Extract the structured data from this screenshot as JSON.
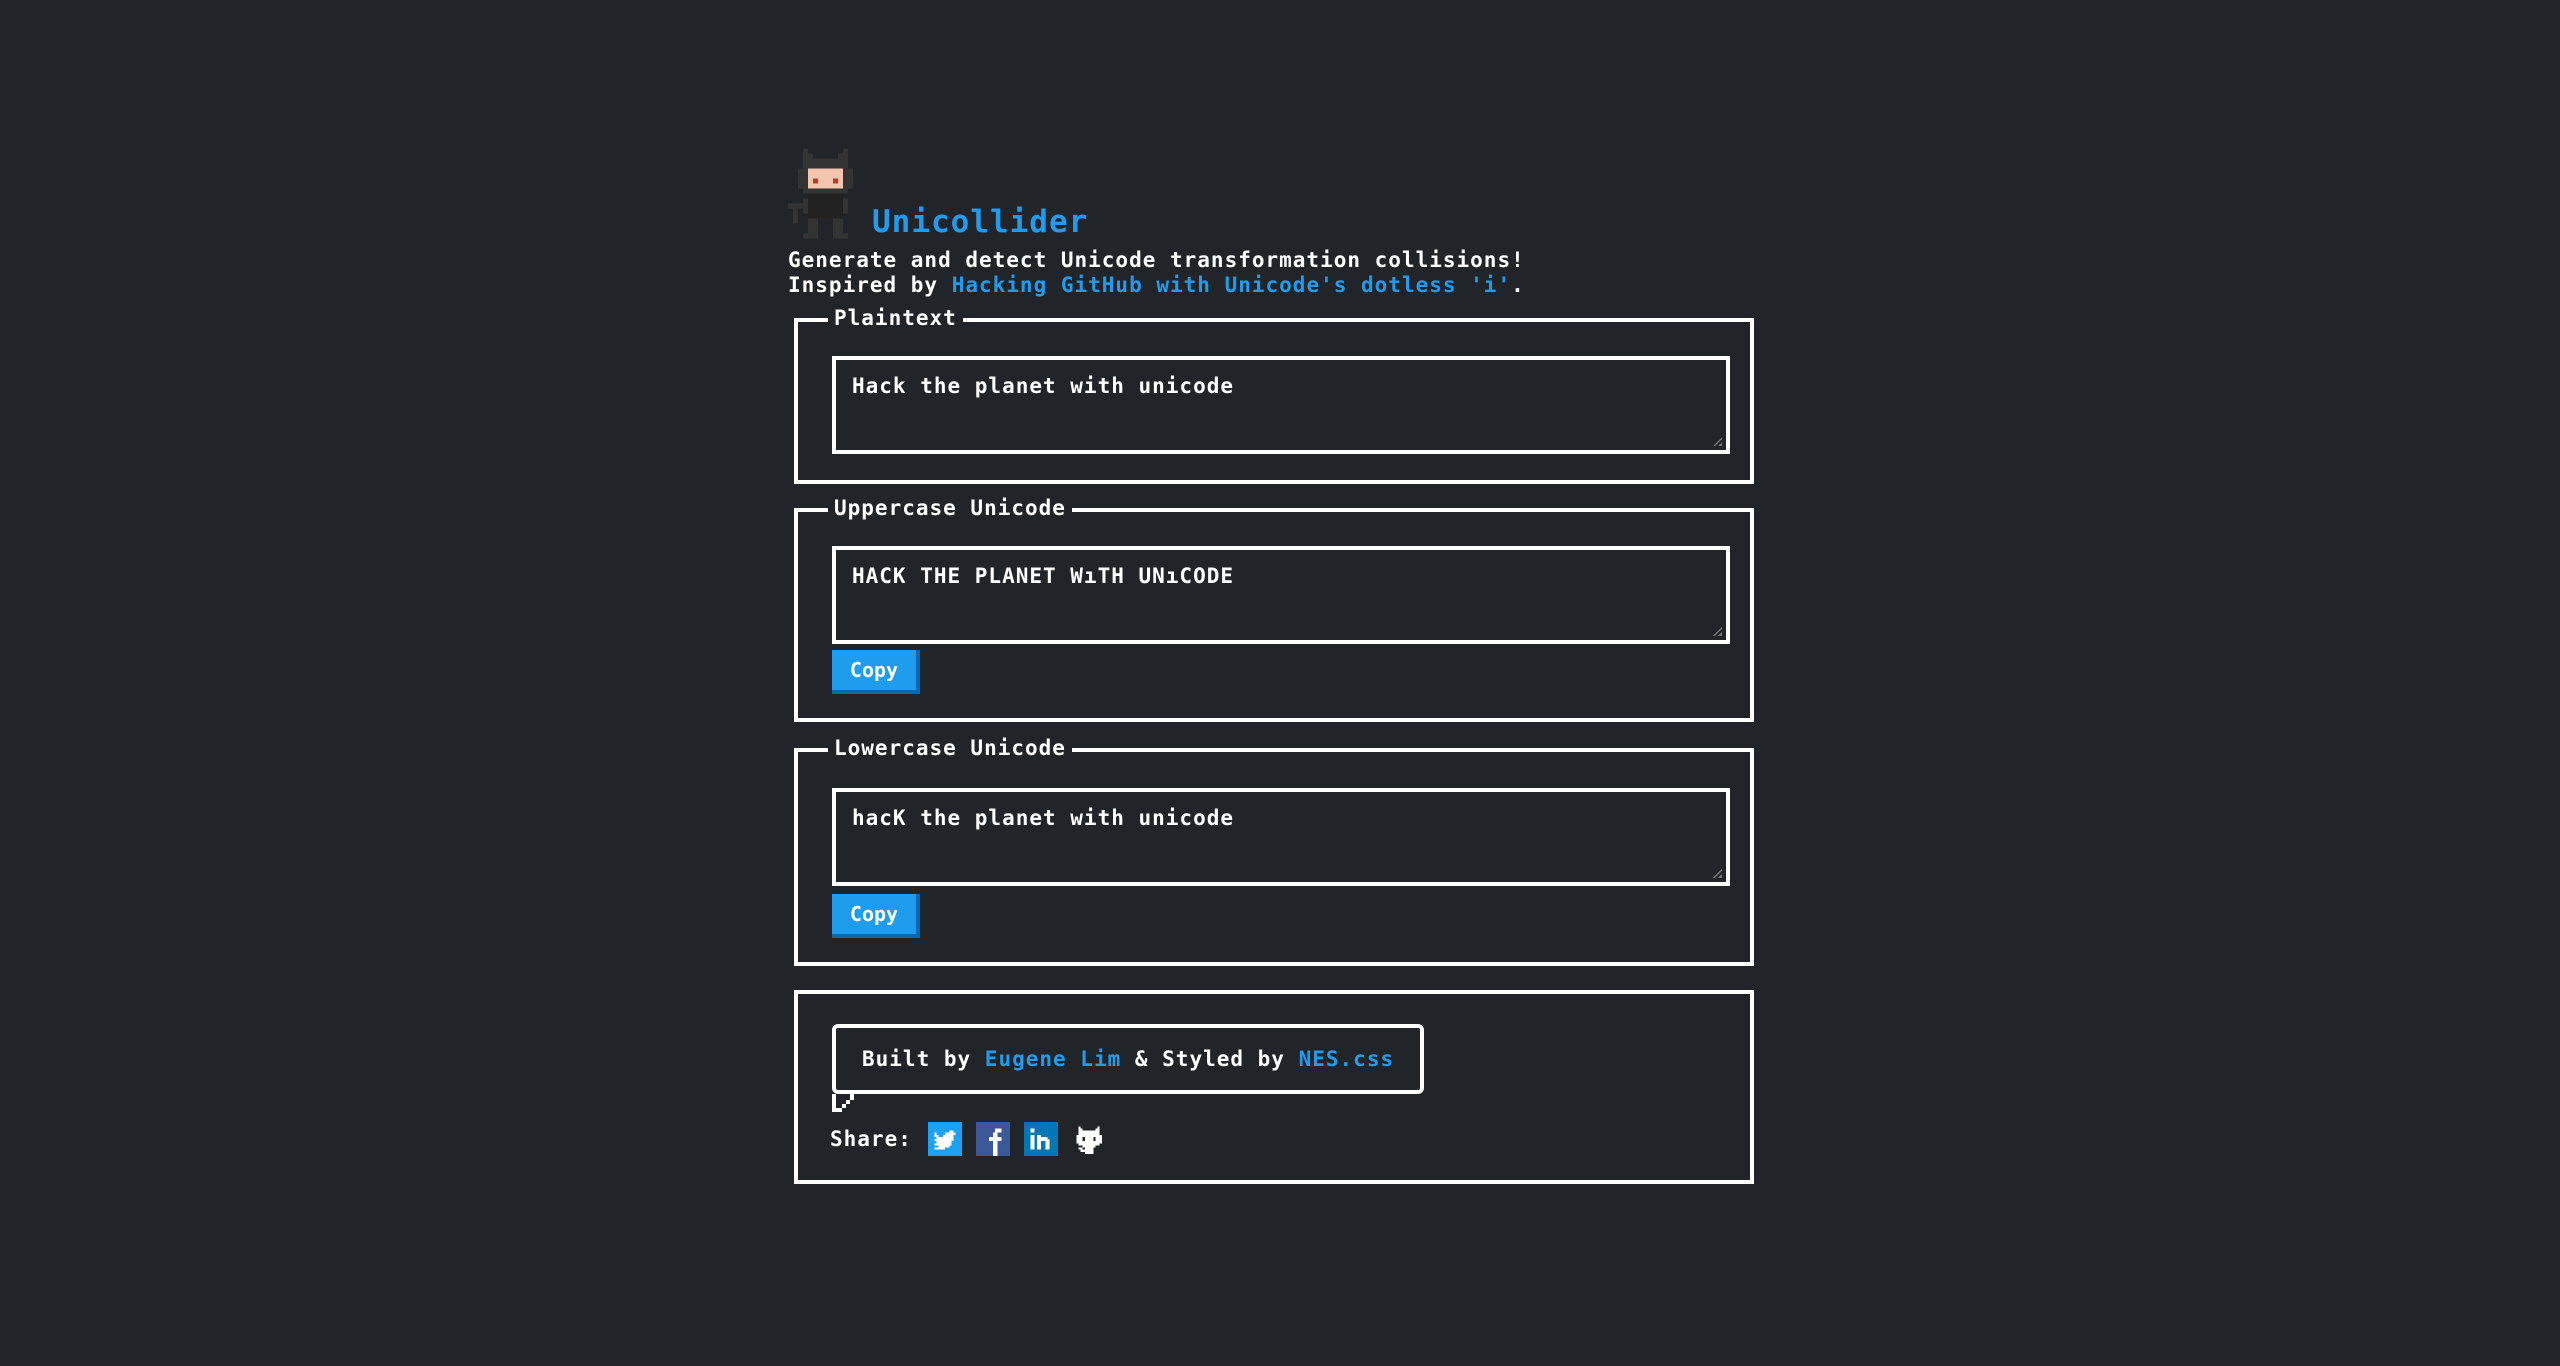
{
  "header": {
    "title": "Unicollider",
    "logo_icon": "pixel-octocat-icon",
    "subtitle_line1": "Generate and detect Unicode transformation collisions!",
    "subtitle_prefix": "Inspired by ",
    "subtitle_link": "Hacking GitHub with Unicode's dotless 'i'",
    "subtitle_suffix": "."
  },
  "plaintext": {
    "title": "Plaintext",
    "value": "Hack the planet with unicode"
  },
  "uppercase": {
    "title": "Uppercase Unicode",
    "value": "HACK THE PLANET WıTH UNıCODE",
    "copy_label": "Copy"
  },
  "lowercase": {
    "title": "Lowercase Unicode",
    "value": "hacK the planet with unicode",
    "copy_label": "Copy"
  },
  "footer": {
    "built_by_prefix": "Built by ",
    "author": "Eugene Lim",
    "styled_by_middle": " & Styled by ",
    "styler": "NES.css",
    "share_label": "Share:",
    "share_icons": [
      "twitter-icon",
      "facebook-icon",
      "linkedin-icon",
      "github-icon"
    ]
  },
  "colors": {
    "background": "#212529",
    "accent": "#209cee",
    "text": "#ffffff",
    "twitter": "#1da1f2",
    "facebook": "#3b5998",
    "linkedin": "#0077b5"
  }
}
